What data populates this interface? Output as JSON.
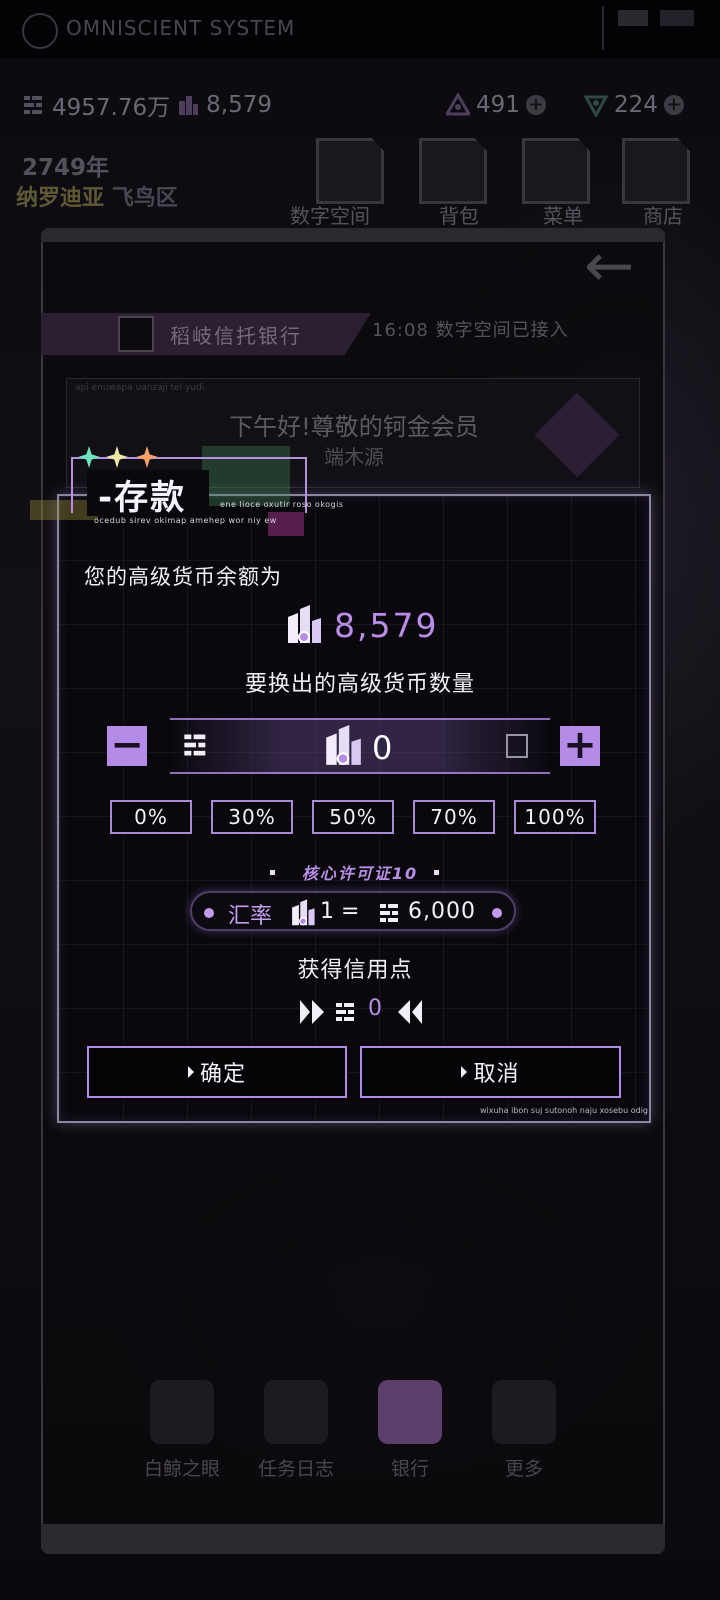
{
  "header": {
    "system_title": "OMNISCIENT SYSTEM",
    "currency_wan": "4957.76万",
    "premium_count": "8,579",
    "resource_a": "491",
    "resource_b": "224",
    "year": "2749年",
    "region": "纳罗迪亚",
    "district": "飞鸟区"
  },
  "top_buttons": [
    {
      "label": "数字空间"
    },
    {
      "label": "背包"
    },
    {
      "label": "菜单"
    },
    {
      "label": "商店"
    }
  ],
  "bank": {
    "name": "稻岐信托银行",
    "status": "16:08 数字空间已接入",
    "greeting_small": "api enuwapa uanzaji tel yudi",
    "greeting": "下午好!尊敬的钶金会员",
    "member_name": "端木源"
  },
  "dialog": {
    "title": "-存款",
    "subtitle_a": "ene lioce oxutir roso okogis",
    "subtitle_b": "ocedub sirev okimap amehep wor niy ew",
    "balance_label": "您的高级货币余额为",
    "balance_value": "8,579",
    "exchange_label": "要换出的高级货币数量",
    "quantity": "0",
    "percent_options": [
      "0%",
      "30%",
      "50%",
      "70%",
      "100%"
    ],
    "license": "核心许可证10",
    "rate_label": "汇率",
    "rate_left": "1 =",
    "rate_right": "6,000",
    "credit_label": "获得信用点",
    "credit_value": "0",
    "confirm": "确定",
    "cancel": "取消",
    "footer": "wixuha ibon suj sutonoh naju xosebu odig"
  },
  "bottom_nav": [
    {
      "label": "白鲸之眼"
    },
    {
      "label": "任务日志"
    },
    {
      "label": "银行"
    },
    {
      "label": "更多"
    }
  ],
  "colors": {
    "accent": "#b48be6",
    "accent_text": "#b98de8",
    "background": "#0c0a10"
  }
}
